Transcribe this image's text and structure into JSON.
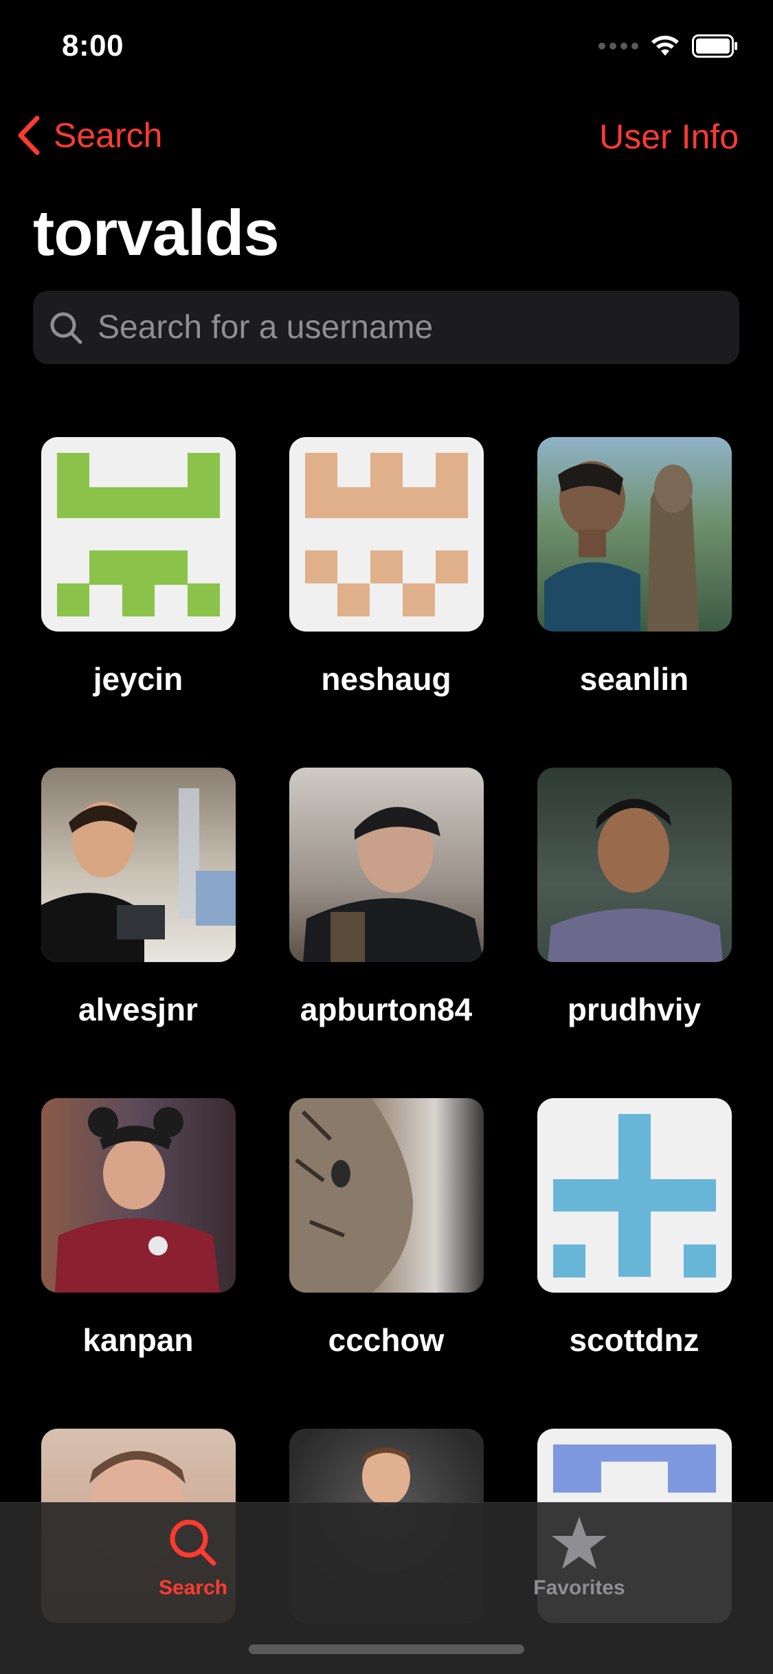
{
  "status": {
    "time": "8:00"
  },
  "nav": {
    "back_label": "Search",
    "right_label": "User Info"
  },
  "page": {
    "title": "torvalds"
  },
  "search": {
    "placeholder": "Search for a username"
  },
  "users": [
    {
      "username": "jeycin",
      "avatar": "identicon-green"
    },
    {
      "username": "neshaug",
      "avatar": "identicon-tan"
    },
    {
      "username": "seanlin",
      "avatar": "photo"
    },
    {
      "username": "alvesjnr",
      "avatar": "photo"
    },
    {
      "username": "apburton84",
      "avatar": "photo"
    },
    {
      "username": "prudhviy",
      "avatar": "photo"
    },
    {
      "username": "kanpan",
      "avatar": "photo"
    },
    {
      "username": "ccchow",
      "avatar": "photo"
    },
    {
      "username": "scottdnz",
      "avatar": "identicon-blue"
    },
    {
      "username": "",
      "avatar": "photo"
    },
    {
      "username": "",
      "avatar": "photo"
    },
    {
      "username": "",
      "avatar": "identicon-periwinkle"
    }
  ],
  "tabs": [
    {
      "label": "Search",
      "icon": "search-icon",
      "active": true
    },
    {
      "label": "Favorites",
      "icon": "star-icon",
      "active": false
    }
  ],
  "colors": {
    "accent": "#ff3b30",
    "identicon_green": "#8bc34a",
    "identicon_tan": "#e0b08a",
    "identicon_blue": "#67b6d8",
    "identicon_periwinkle": "#7f99e0"
  }
}
